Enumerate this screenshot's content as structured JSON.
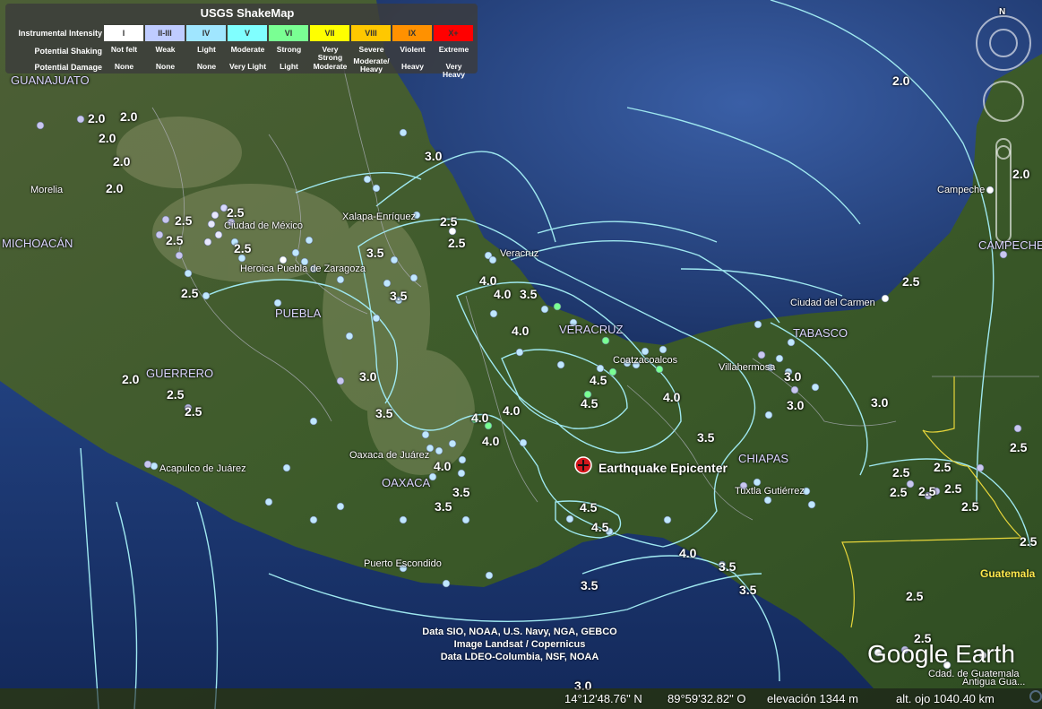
{
  "legend": {
    "title": "USGS ShakeMap",
    "row_labels": [
      "Instrumental Intensity",
      "Potential Shaking",
      "Potential Damage"
    ],
    "intensities": [
      {
        "roman": "I",
        "shaking": "Not felt",
        "damage": "None",
        "color": "#ffffff"
      },
      {
        "roman": "II-III",
        "shaking": "Weak",
        "damage": "None",
        "color": "#bfccff"
      },
      {
        "roman": "IV",
        "shaking": "Light",
        "damage": "None",
        "color": "#a0e6ff"
      },
      {
        "roman": "V",
        "shaking": "Moderate",
        "damage": "Very Light",
        "color": "#80ffff"
      },
      {
        "roman": "VI",
        "shaking": "Strong",
        "damage": "Light",
        "color": "#7aff93"
      },
      {
        "roman": "VII",
        "shaking": "Very Strong",
        "damage": "Moderate",
        "color": "#ffff00"
      },
      {
        "roman": "VIII",
        "shaking": "Severe",
        "damage": "Moderate/ Heavy",
        "color": "#ffc800"
      },
      {
        "roman": "IX",
        "shaking": "Violent",
        "damage": "Heavy",
        "color": "#ff9100"
      },
      {
        "roman": "X+",
        "shaking": "Extreme",
        "damage": "Very Heavy",
        "color": "#ff0000"
      }
    ]
  },
  "places": [
    {
      "name": "Morelia"
    },
    {
      "name": "Ciudad de México"
    },
    {
      "name": "Heroica Puebla de Zaragoza"
    },
    {
      "name": "Xalapa-Enríquez"
    },
    {
      "name": "Veracruz"
    },
    {
      "name": "Coatzacoalcos"
    },
    {
      "name": "Villahermosa"
    },
    {
      "name": "Ciudad del Carmen"
    },
    {
      "name": "Campeche"
    },
    {
      "name": "Acapulco de Juárez"
    },
    {
      "name": "Oaxaca de Juárez"
    },
    {
      "name": "Puerto Escondido"
    },
    {
      "name": "Tuxtla Gutiérrez"
    },
    {
      "name": "Antigua Gua..."
    },
    {
      "name": "Cdad. de Guatemala"
    }
  ],
  "regions": [
    "GUANAJUATO",
    "MICHOACÁN",
    "PUEBLA",
    "GUERRERO",
    "OAXACA",
    "VERACRUZ",
    "TABASCO",
    "CHIAPAS",
    "CAMPECHE"
  ],
  "country_label": "Guatemala",
  "contour_values": [
    "2.0",
    "2.0",
    "2.0",
    "2.0",
    "2.0",
    "2.0",
    "2.0",
    "2.0",
    "2.5",
    "2.5",
    "2.5",
    "2.5",
    "2.5",
    "2.5",
    "2.5",
    "2.5",
    "2.5",
    "2.5",
    "2.5",
    "2.5",
    "2.5",
    "2.5",
    "2.5",
    "2.5",
    "2.5",
    "2.5",
    "2.5",
    "2.5",
    "3.0",
    "3.0",
    "3.0",
    "3.0",
    "3.0",
    "3.0",
    "3.5",
    "3.5",
    "3.5",
    "3.5",
    "3.5",
    "3.5",
    "3.5",
    "3.5",
    "3.5",
    "3.5",
    "4.0",
    "4.0",
    "4.0",
    "4.0",
    "4.0",
    "4.0",
    "4.0",
    "4.0",
    "4.0",
    "4.5",
    "4.5",
    "4.5",
    "4.5"
  ],
  "epicenter_label": "Earthquake Epicenter",
  "attribution": [
    "Data SIO, NOAA, U.S. Navy, NGA, GEBCO",
    "Image Landsat / Copernicus",
    "Data LDEO-Columbia, NSF, NOAA"
  ],
  "logo": "Google Earth",
  "status": {
    "lat": "14°12'48.76\" N",
    "lon": "89°59'32.82\" O",
    "elevation": "elevación  1344 m",
    "eye_alt": "alt. ojo 1040.40 km"
  },
  "compass_label": "N",
  "colors": {
    "contour": "#9fe8f0",
    "ocean": "#1f3b78",
    "land": "#3b5a2a",
    "epicenter": "#d4171c"
  }
}
